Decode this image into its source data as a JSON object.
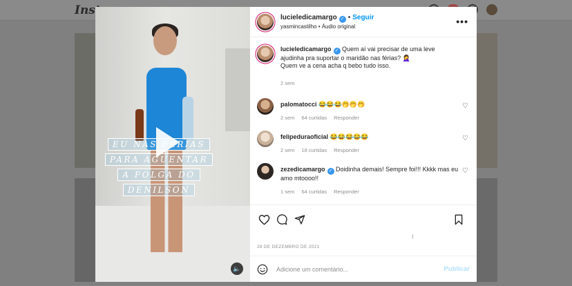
{
  "background": {
    "logo": "Insta"
  },
  "overlay": {
    "caption_lines": [
      "EU NAS FÉRIAS",
      "PARA AGUENTAR",
      "A FOLGA DO",
      "DENILSON"
    ]
  },
  "post": {
    "author": "lucieledicamargo",
    "follow_label": "Seguir",
    "audio": "yasmincastilho • Áudio original",
    "caption_text": "Quem aí vai precisar de uma leve ajudinha pra suportar o maridão nas férias? 🤦‍♀️",
    "caption_line2": "Quem ve a cena acha q bebo tudo isso.",
    "caption_time": "2 sem",
    "date": "28 DE DEZEMBRO DE 2021"
  },
  "comments": [
    {
      "user": "palomatocci",
      "text": "😂😂😂🤭🤭🤭",
      "time": "2 sem",
      "likes": "64 curtidas",
      "reply": "Responder"
    },
    {
      "user": "felipeduraoficial",
      "text": "😂😂😂😂😂",
      "time": "2 sem",
      "likes": "18 curtidas",
      "reply": "Responder"
    },
    {
      "user": "zezedicamargo",
      "text": "Doidinha demais! Sempre foi!!! Kkkk mas eu amo mtoooo!!",
      "time": "1 sem",
      "likes": "64 curtidas",
      "reply": "Responder"
    }
  ],
  "comment_box": {
    "placeholder": "Adicione um comentário...",
    "publish_label": "Publicar"
  },
  "icons": [
    "heart-icon",
    "comment-icon",
    "share-icon",
    "bookmark-icon",
    "emoji-icon",
    "more-icon",
    "play-icon",
    "sound-icon"
  ],
  "colors": {
    "accent": "#0095f6",
    "verified": "#3897f0",
    "publish_disabled": "#b2dffc"
  }
}
